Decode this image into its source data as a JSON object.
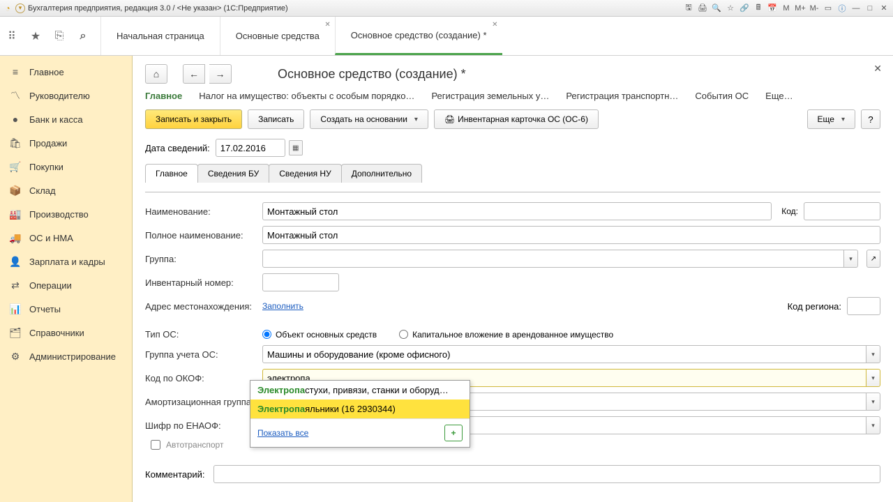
{
  "window": {
    "title": "Бухгалтерия предприятия, редакция 3.0 / <Не указан>  (1С:Предприятие)"
  },
  "topbar": {
    "tabs": [
      {
        "label": "Начальная страница",
        "closable": false
      },
      {
        "label": "Основные средства",
        "closable": true
      },
      {
        "label": "Основное средство (создание) *",
        "closable": true,
        "active": true
      }
    ]
  },
  "sidebar": {
    "items": [
      {
        "label": "Главное",
        "icon": "≡"
      },
      {
        "label": "Руководителю",
        "icon": "〽"
      },
      {
        "label": "Банк и касса",
        "icon": "●"
      },
      {
        "label": "Продажи",
        "icon": "🛍"
      },
      {
        "label": "Покупки",
        "icon": "🛒"
      },
      {
        "label": "Склад",
        "icon": "📦"
      },
      {
        "label": "Производство",
        "icon": "🏭"
      },
      {
        "label": "ОС и НМА",
        "icon": "🚚"
      },
      {
        "label": "Зарплата и кадры",
        "icon": "👤"
      },
      {
        "label": "Операции",
        "icon": "⇄"
      },
      {
        "label": "Отчеты",
        "icon": "📊"
      },
      {
        "label": "Справочники",
        "icon": "🗂"
      },
      {
        "label": "Администрирование",
        "icon": "⚙"
      }
    ]
  },
  "page": {
    "title": "Основное средство (создание) *",
    "tabnav": [
      "Главное",
      "Налог на имущество: объекты с особым порядко…",
      "Регистрация земельных у…",
      "Регистрация транспортн…",
      "События ОС",
      "Еще…"
    ],
    "toolbar": {
      "save_close": "Записать и закрыть",
      "save": "Записать",
      "create_based": "Создать на основании",
      "print_card": "Инвентарная карточка ОС (ОС-6)",
      "more": "Еще",
      "help": "?"
    },
    "date_label": "Дата сведений:",
    "date_value": "17.02.2016",
    "subtabs": [
      "Главное",
      "Сведения БУ",
      "Сведения НУ",
      "Дополнительно"
    ],
    "fields": {
      "name_label": "Наименование:",
      "name_value": "Монтажный стол",
      "code_label": "Код:",
      "code_value": "",
      "fullname_label": "Полное наименование:",
      "fullname_value": "Монтажный стол",
      "group_label": "Группа:",
      "group_value": "",
      "invnum_label": "Инвентарный номер:",
      "invnum_value": "",
      "addr_label": "Адрес местонахождения:",
      "addr_link": "Заполнить",
      "region_label": "Код региона:",
      "region_value": "",
      "ostype_label": "Тип ОС:",
      "ostype_opt1": "Объект основных средств",
      "ostype_opt2": "Капитальное вложение в арендованное имущество",
      "accgroup_label": "Группа учета ОС:",
      "accgroup_value": "Машины и оборудование (кроме офисного)",
      "okof_label": "Код по ОКОФ:",
      "okof_value": "электропа",
      "amgroup_label": "Амортизационная группа:",
      "amgroup_value": "",
      "enaof_label": "Шифр по ЕНАОФ:",
      "enaof_value": "",
      "auto_label": "Автотранспорт",
      "comment_label": "Комментарий:",
      "comment_value": ""
    },
    "dropdown": {
      "items": [
        {
          "hl": "Электропа",
          "rest": "стухи, привязи, станки и оборуд…"
        },
        {
          "hl": "Электропа",
          "rest": "яльники (16 2930344)",
          "selected": true
        }
      ],
      "show_all": "Показать все"
    }
  }
}
